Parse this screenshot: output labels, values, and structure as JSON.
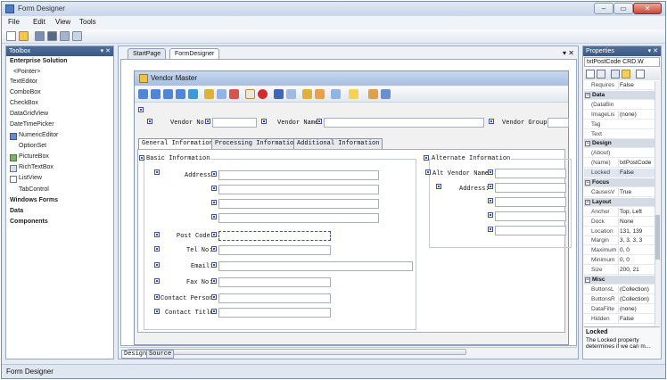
{
  "window": {
    "title": "Form Designer",
    "min": "–",
    "max": "▭",
    "close": "✕"
  },
  "menu": [
    "File",
    "Edit",
    "View",
    "Tools"
  ],
  "toolbox": {
    "title": "Toolbox",
    "pin": "▾ ✕",
    "items": [
      {
        "label": "Enterprise Solution",
        "category": true
      },
      {
        "label": "<Pointer>"
      },
      {
        "label": "TextEditor"
      },
      {
        "label": "ComboBox"
      },
      {
        "label": "CheckBox"
      },
      {
        "label": "DataGridView"
      },
      {
        "label": "DateTimePicker"
      },
      {
        "label": "NumericEditor"
      },
      {
        "label": "OptionSet"
      },
      {
        "label": "PictureBox"
      },
      {
        "label": "RichTextBox"
      },
      {
        "label": "ListView"
      },
      {
        "label": "TabControl"
      },
      {
        "label": "Windows Forms",
        "category": true
      },
      {
        "label": "Data",
        "category": true
      },
      {
        "label": "Components",
        "category": true
      }
    ]
  },
  "doc_tabs": [
    "StartPage",
    "FormDesigner"
  ],
  "doc_tab_close": "▾ ✕",
  "form": {
    "title": "Vendor Master",
    "header_fields": {
      "vendor_no": "Vendor No:",
      "vendor_name": "Vendor Name:",
      "vendor_group": "Vendor Group:"
    },
    "tabs": [
      "General Information",
      "Processing Information",
      "Additional Information"
    ],
    "basic_group": "Basic Information",
    "alternate_group": "Alternate Information",
    "labels": {
      "address": "Address:",
      "post_code": "Post Code:",
      "tel_no": "Tel No:",
      "email": "Email:",
      "fax_no": "Fax No:",
      "contact_person": "Contact Person:",
      "contact_title": "Contact Title:",
      "alt_vendor_name": "Alt Vendor Name:",
      "alt_address": "Address:"
    }
  },
  "bottom_tabs": [
    "Design",
    "Source"
  ],
  "properties": {
    "title": "Properties",
    "pin": "▾ ✕",
    "selected": "txtPostCode  CRD.W",
    "rows": [
      {
        "name": "Requires",
        "value": "False"
      },
      {
        "cat": true,
        "name": "Data"
      },
      {
        "name": "(DataBin",
        "value": ""
      },
      {
        "name": "ImageLis",
        "value": "(none)"
      },
      {
        "name": "Tag",
        "value": ""
      },
      {
        "name": "Text",
        "value": ""
      },
      {
        "cat": true,
        "name": "Design"
      },
      {
        "name": "(About)",
        "value": ""
      },
      {
        "name": "(Name)",
        "value": "txtPostCode"
      },
      {
        "name": "Locked",
        "value": "False",
        "hl": true
      },
      {
        "cat": true,
        "name": "Focus"
      },
      {
        "name": "CausesV",
        "value": "True"
      },
      {
        "cat": true,
        "name": "Layout"
      },
      {
        "name": "Anchor",
        "value": "Top, Left"
      },
      {
        "name": "Dock",
        "value": "None"
      },
      {
        "name": "Location",
        "value": "131, 139"
      },
      {
        "name": "Margin",
        "value": "3, 3, 3, 3"
      },
      {
        "name": "Maximum",
        "value": "0, 0"
      },
      {
        "name": "Minimum",
        "value": "0, 0"
      },
      {
        "name": "Size",
        "value": "200, 21"
      },
      {
        "cat": true,
        "name": "Misc"
      },
      {
        "name": "ButtonsL",
        "value": "(Collection)"
      },
      {
        "name": "ButtonsR",
        "value": "(Collection)"
      },
      {
        "name": "DataFilte",
        "value": "(none)"
      },
      {
        "name": "Hidden",
        "value": "False"
      }
    ],
    "desc_title": "Locked",
    "desc_text": "The Locked property determines if we can m..."
  },
  "status": "Form Designer",
  "colors": {
    "panel_header": "#3b5a85",
    "selection_handle": "#3b4fa6",
    "form_title": "#a7bfe2"
  }
}
